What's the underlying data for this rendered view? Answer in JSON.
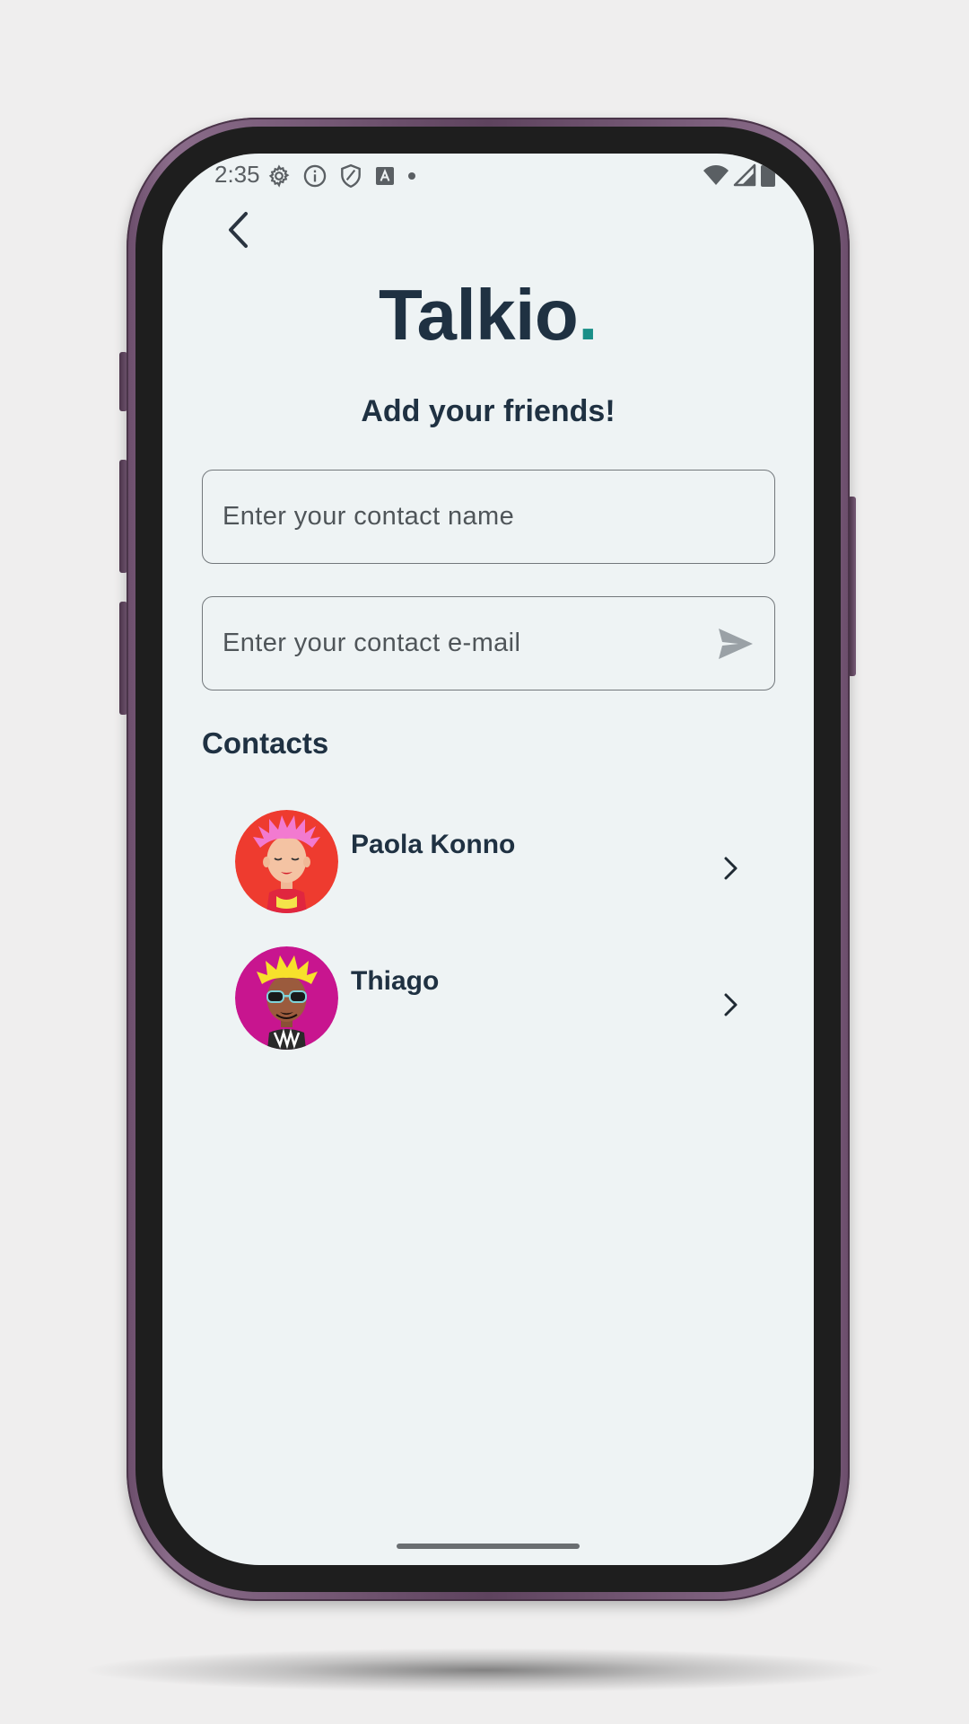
{
  "status_bar": {
    "time": "2:35",
    "left_icons": [
      "gear-icon",
      "info-icon",
      "shield-icon",
      "font-a-icon",
      "dot-icon"
    ],
    "right_icons": [
      "wifi-icon",
      "signal-icon",
      "battery-icon"
    ]
  },
  "header": {
    "back_icon": "chevron-left-icon",
    "logo_text": "Talkio",
    "logo_dot": ".",
    "logo_color": "#1f3142",
    "accent_color": "#1a8f88"
  },
  "main": {
    "subtitle": "Add your friends!",
    "name_field": {
      "placeholder": "Enter your contact name",
      "value": ""
    },
    "email_field": {
      "placeholder": "Enter your contact e-mail",
      "value": "",
      "send_icon": "send-icon"
    },
    "contacts_title": "Contacts",
    "contacts": [
      {
        "name": "Paola Konno",
        "avatar": "avatar-pink-hair",
        "chevron": "chevron-right-icon"
      },
      {
        "name": "Thiago",
        "avatar": "avatar-sunglasses",
        "chevron": "chevron-right-icon"
      }
    ]
  }
}
